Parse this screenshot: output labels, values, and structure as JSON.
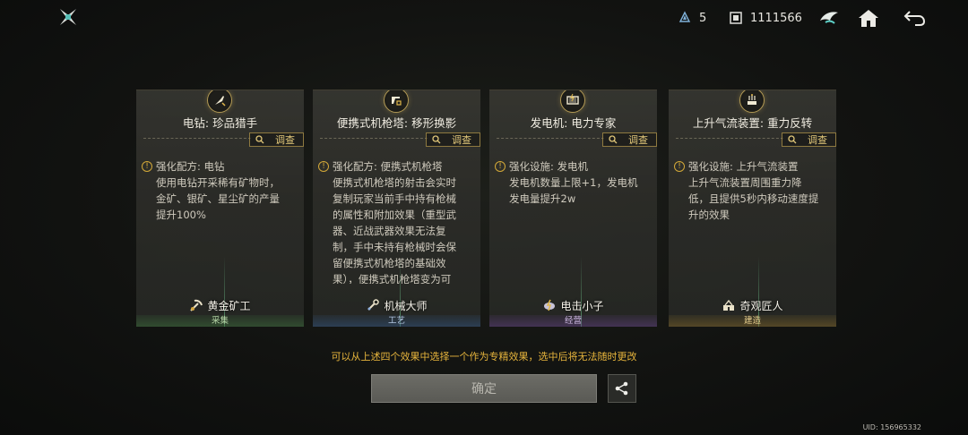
{
  "header": {
    "logo_icon": "shuriken-icon",
    "shards": "5",
    "coins": "1111566",
    "hint_icon": "crow-hint-icon",
    "home_icon": "home-icon",
    "back_icon": "back-arrow-icon"
  },
  "cards": [
    {
      "icon": "drill-icon",
      "title": "电钻: 珍品猎手",
      "investigate": "调查",
      "effect_type": "强化配方: 电钻",
      "effect_text": "使用电钻开采稀有矿物时，\n金矿、银矿、星尘矿的产量\n提升100%",
      "job_icon": "pickaxe-icon",
      "job": "黄金矿工",
      "category": "采集",
      "category_color": "#3c6e3c"
    },
    {
      "icon": "turret-icon",
      "title": "便携式机枪塔: 移形换影",
      "investigate": "调查",
      "effect_type": "强化配方: 便携式机枪塔",
      "effect_text": "便携式机枪塔的射击会实时\n复制玩家当前手中持有枪械\n的属性和附加效果（重型武\n器、近战武器效果无法复\n制，手中未持有枪械时会保\n留便携式机枪塔的基础效\n果），便携式机枪塔变为可\n重复使用道具，冷却时",
      "job_icon": "wrench-icon",
      "job": "机械大师",
      "category": "工艺",
      "category_color": "#325078"
    },
    {
      "icon": "generator-icon",
      "title": "发电机: 电力专家",
      "investigate": "调查",
      "effect_type": "强化设施: 发电机",
      "effect_text": "发电机数量上限+1，发电机\n发电量提升2w",
      "job_icon": "lightning-icon",
      "job": "电击小子",
      "category": "经营",
      "category_color": "#5a3c78"
    },
    {
      "icon": "updraft-icon",
      "title": "上升气流装置: 重力反转",
      "investigate": "调查",
      "effect_type": "强化设施: 上升气流装置",
      "effect_text": "上升气流装置周围重力降\n低，且提供5秒内移动速度提\n升的效果",
      "job_icon": "builder-icon",
      "job": "奇观匠人",
      "category": "建造",
      "category_color": "#785f28"
    }
  ],
  "notice": "可以从上述四个效果中选择一个作为专精效果，选中后将无法随时更改",
  "confirm_label": "确定",
  "share_icon": "share-icon",
  "uid": "UID: 156965332"
}
